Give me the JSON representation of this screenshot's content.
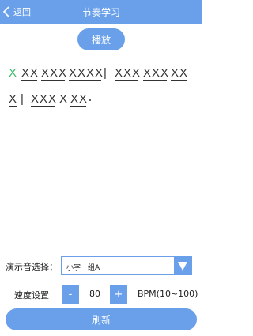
{
  "header": {
    "back_label": "返回",
    "title": "节奏学习"
  },
  "play_label": "播放",
  "notation": {
    "line1": [
      "X",
      "XX",
      "XXX",
      "XXXX",
      "|",
      "XXX",
      "XXX",
      "XX"
    ],
    "line2": [
      "X",
      "|",
      "XXX",
      "X",
      "XX"
    ],
    "active_note": "X"
  },
  "sound_select": {
    "label": "演示音选择：",
    "value": "小字一组A"
  },
  "speed": {
    "label": "速度设置",
    "minus": "-",
    "value": "80",
    "plus": "+",
    "range": "BPM(10~100)"
  },
  "refresh_label": "刷新",
  "colors": {
    "accent": "#6aa0ea",
    "active_note": "#3dbb6a"
  }
}
